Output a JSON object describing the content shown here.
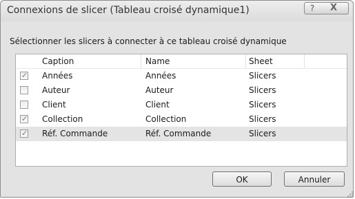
{
  "dialog": {
    "title": "Connexions de slicer (Tableau croisé dynamique1)",
    "help_glyph": "?",
    "close_glyph": "X",
    "instruction": "Sélectionner les slicers à connecter à ce tableau croisé dynamique"
  },
  "table": {
    "columns": [
      "Caption",
      "Name",
      "Sheet"
    ],
    "rows": [
      {
        "checked": true,
        "caption": "Années",
        "name": "Années",
        "sheet": "Slicers"
      },
      {
        "checked": false,
        "caption": "Auteur",
        "name": "Auteur",
        "sheet": "Slicers"
      },
      {
        "checked": false,
        "caption": "Client",
        "name": "Client",
        "sheet": "Slicers"
      },
      {
        "checked": true,
        "caption": "Collection",
        "name": "Collection",
        "sheet": "Slicers"
      },
      {
        "checked": true,
        "caption": "Réf. Commande",
        "name": "Réf. Commande",
        "sheet": "Slicers",
        "selected": true
      }
    ]
  },
  "buttons": {
    "ok": "OK",
    "cancel": "Annuler"
  },
  "icons": {
    "help": "help-icon",
    "close": "close-icon",
    "check": "checkmark-icon",
    "grip": "resize-grip-icon"
  },
  "colors": {
    "dialog_bg": "#f0f0f0",
    "selected_row": "#e4e4e4"
  }
}
